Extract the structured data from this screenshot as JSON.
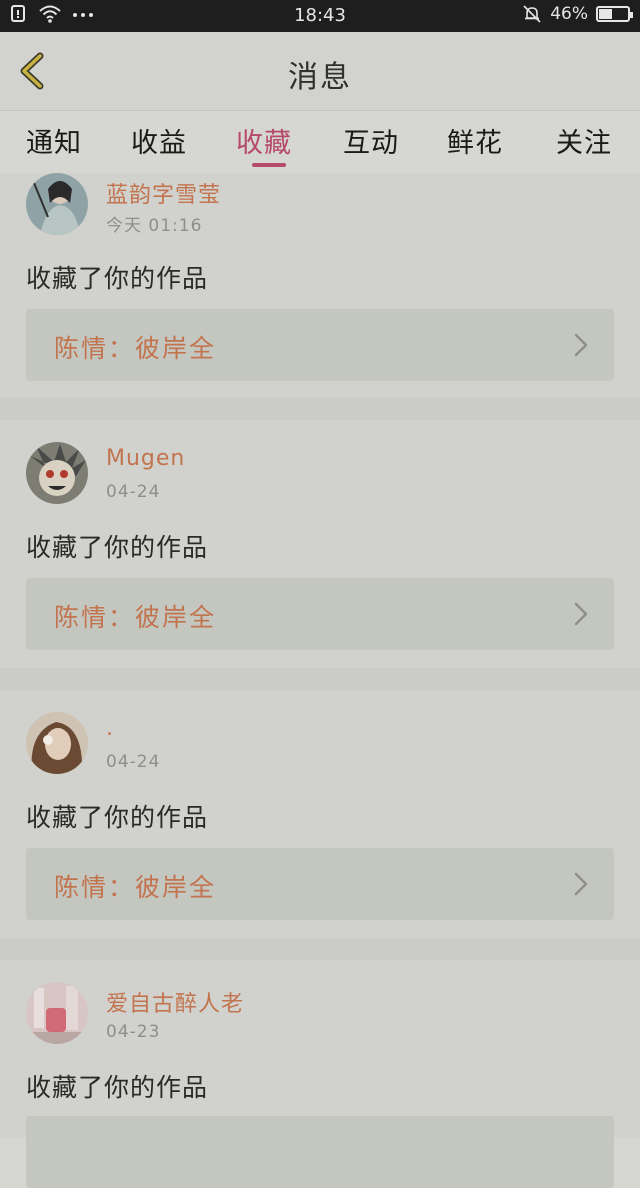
{
  "status_bar": {
    "time": "18:43",
    "battery": "46%",
    "battery_level": 0.46,
    "icons": [
      "notification-icon",
      "wifi-icon",
      "more-dots-icon",
      "mute-bell-icon",
      "battery-icon"
    ]
  },
  "header": {
    "title": "消息",
    "back_icon": "chevron-left-icon"
  },
  "tabs": [
    {
      "label": "通知",
      "active": false
    },
    {
      "label": "收益",
      "active": false
    },
    {
      "label": "收藏",
      "active": true
    },
    {
      "label": "互动",
      "active": false
    },
    {
      "label": "鲜花",
      "active": false
    },
    {
      "label": "关注",
      "active": false
    }
  ],
  "accent_color": "#b54a6c",
  "name_color": "#c2744f",
  "messages": [
    {
      "user": "蓝韵字雪莹",
      "time": "今天 01:16",
      "action": "收藏了你的作品",
      "work": "陈情：彼岸全"
    },
    {
      "user": "Mugen",
      "time": "04-24",
      "action": "收藏了你的作品",
      "work": "陈情：彼岸全"
    },
    {
      "user": ".",
      "time": "04-24",
      "action": "收藏了你的作品",
      "work": "陈情：彼岸全"
    },
    {
      "user": "爱自古醉人老",
      "time": "04-23",
      "action": "收藏了你的作品",
      "work": ""
    }
  ]
}
